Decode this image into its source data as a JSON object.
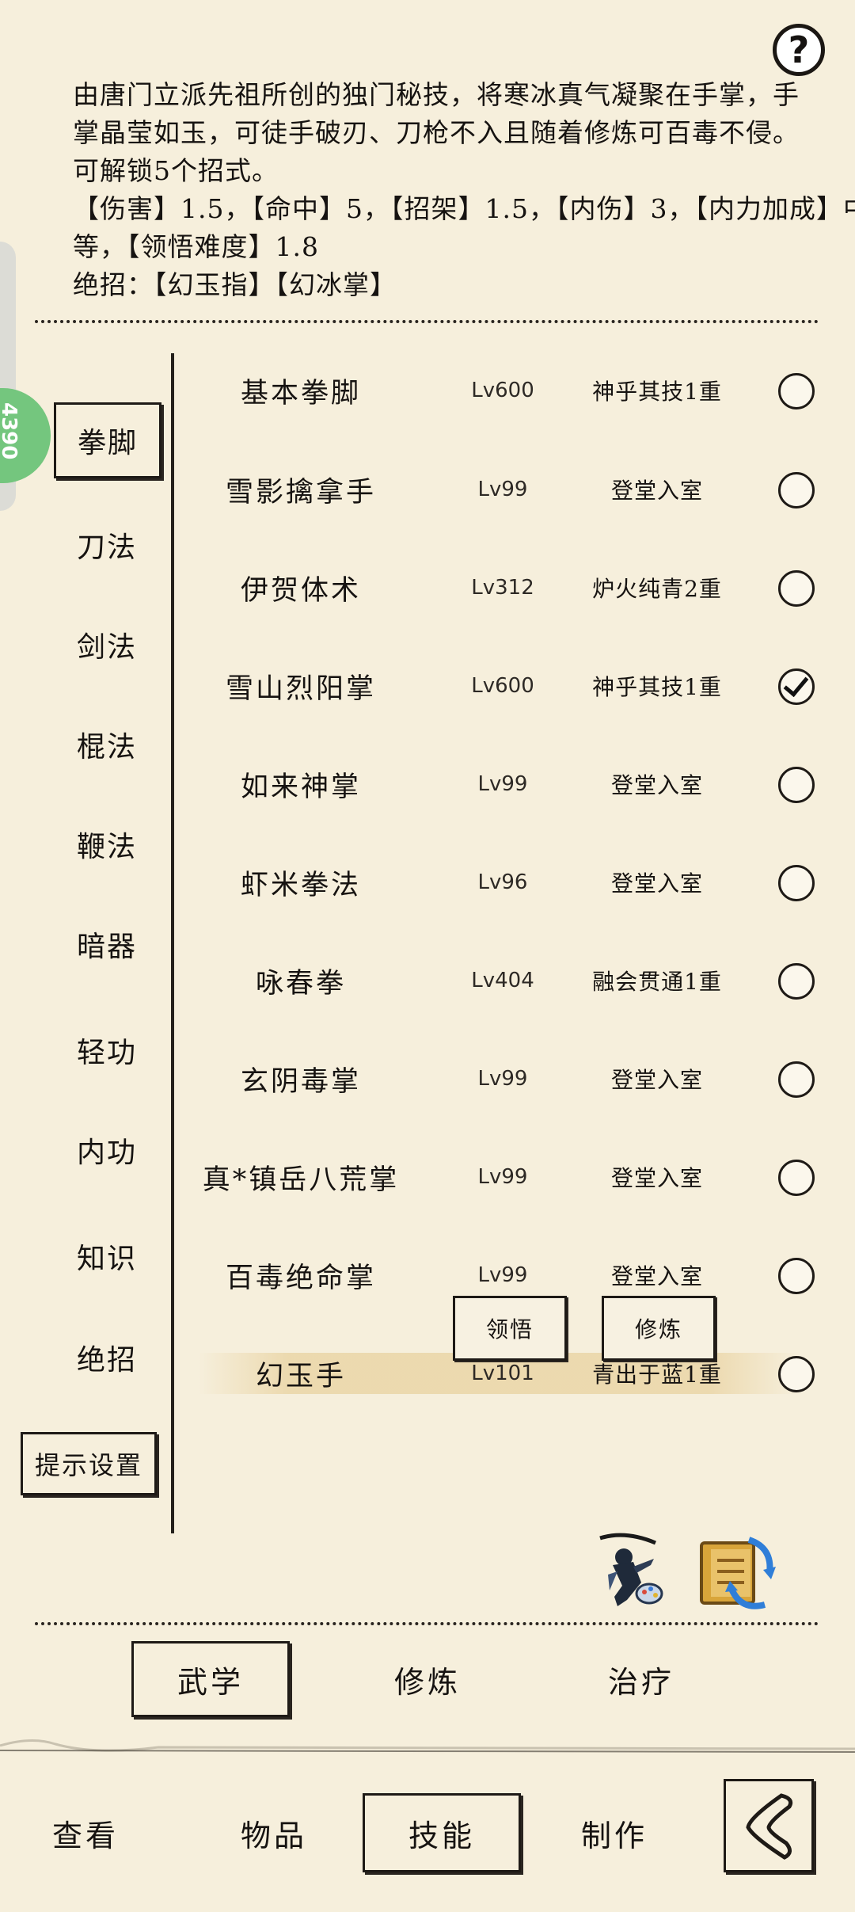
{
  "help": {
    "label": "?"
  },
  "side_badge": {
    "text": "4390"
  },
  "description": {
    "lines": [
      "由唐门立派先祖所创的独门秘技，将寒冰真气凝聚在手掌，手",
      "掌晶莹如玉，可徒手破刃、刀枪不入且随着修炼可百毒不侵。",
      "可解锁5个招式。",
      "【伤害】1.5，【命中】5，【招架】1.5，【内伤】3，【内力加成】中",
      "等，【领悟难度】1.8",
      "绝招：【幻玉指】【幻冰掌】"
    ]
  },
  "categories": [
    {
      "label": "拳脚",
      "active": true
    },
    {
      "label": "刀法"
    },
    {
      "label": "剑法"
    },
    {
      "label": "棍法"
    },
    {
      "label": "鞭法"
    },
    {
      "label": "暗器"
    },
    {
      "label": "轻功"
    },
    {
      "label": "内功"
    },
    {
      "label": "知识"
    },
    {
      "label": "绝招"
    }
  ],
  "tip_settings": "提示设置",
  "skills": [
    {
      "name": "基本拳脚",
      "level": "Lv600",
      "rank": "神乎其技1重",
      "checked": false
    },
    {
      "name": "雪影擒拿手",
      "level": "Lv99",
      "rank": "登堂入室",
      "checked": false
    },
    {
      "name": "伊贺体术",
      "level": "Lv312",
      "rank": "炉火纯青2重",
      "checked": false
    },
    {
      "name": "雪山烈阳掌",
      "level": "Lv600",
      "rank": "神乎其技1重",
      "checked": true
    },
    {
      "name": "如来神掌",
      "level": "Lv99",
      "rank": "登堂入室",
      "checked": false
    },
    {
      "name": "虾米拳法",
      "level": "Lv96",
      "rank": "登堂入室",
      "checked": false
    },
    {
      "name": "咏春拳",
      "level": "Lv404",
      "rank": "融会贯通1重",
      "checked": false
    },
    {
      "name": "玄阴毒掌",
      "level": "Lv99",
      "rank": "登堂入室",
      "checked": false
    },
    {
      "name": "真*镇岳八荒掌",
      "level": "Lv99",
      "rank": "登堂入室",
      "checked": false
    },
    {
      "name": "百毒绝命掌",
      "level": "Lv99",
      "rank": "登堂入室",
      "checked": false
    },
    {
      "name": "幻玉手",
      "level": "Lv101",
      "rank": "青出于蓝1重",
      "checked": false
    }
  ],
  "skill_actions": {
    "comprehend": "领悟",
    "practice": "修炼"
  },
  "sub_tabs": [
    {
      "label": "武学",
      "active": true
    },
    {
      "label": "修炼"
    },
    {
      "label": "治疗"
    }
  ],
  "nav_tabs": [
    {
      "label": "查看"
    },
    {
      "label": "物品"
    },
    {
      "label": "技能",
      "active": true
    },
    {
      "label": "制作"
    }
  ],
  "icons": {
    "ninja": "ninja-portrait-icon",
    "swap": "book-swap-icon",
    "back": "back-arrow-icon"
  },
  "colors": {
    "background": "#f6efdc",
    "ink": "#161311",
    "badge": "#74c67e"
  }
}
